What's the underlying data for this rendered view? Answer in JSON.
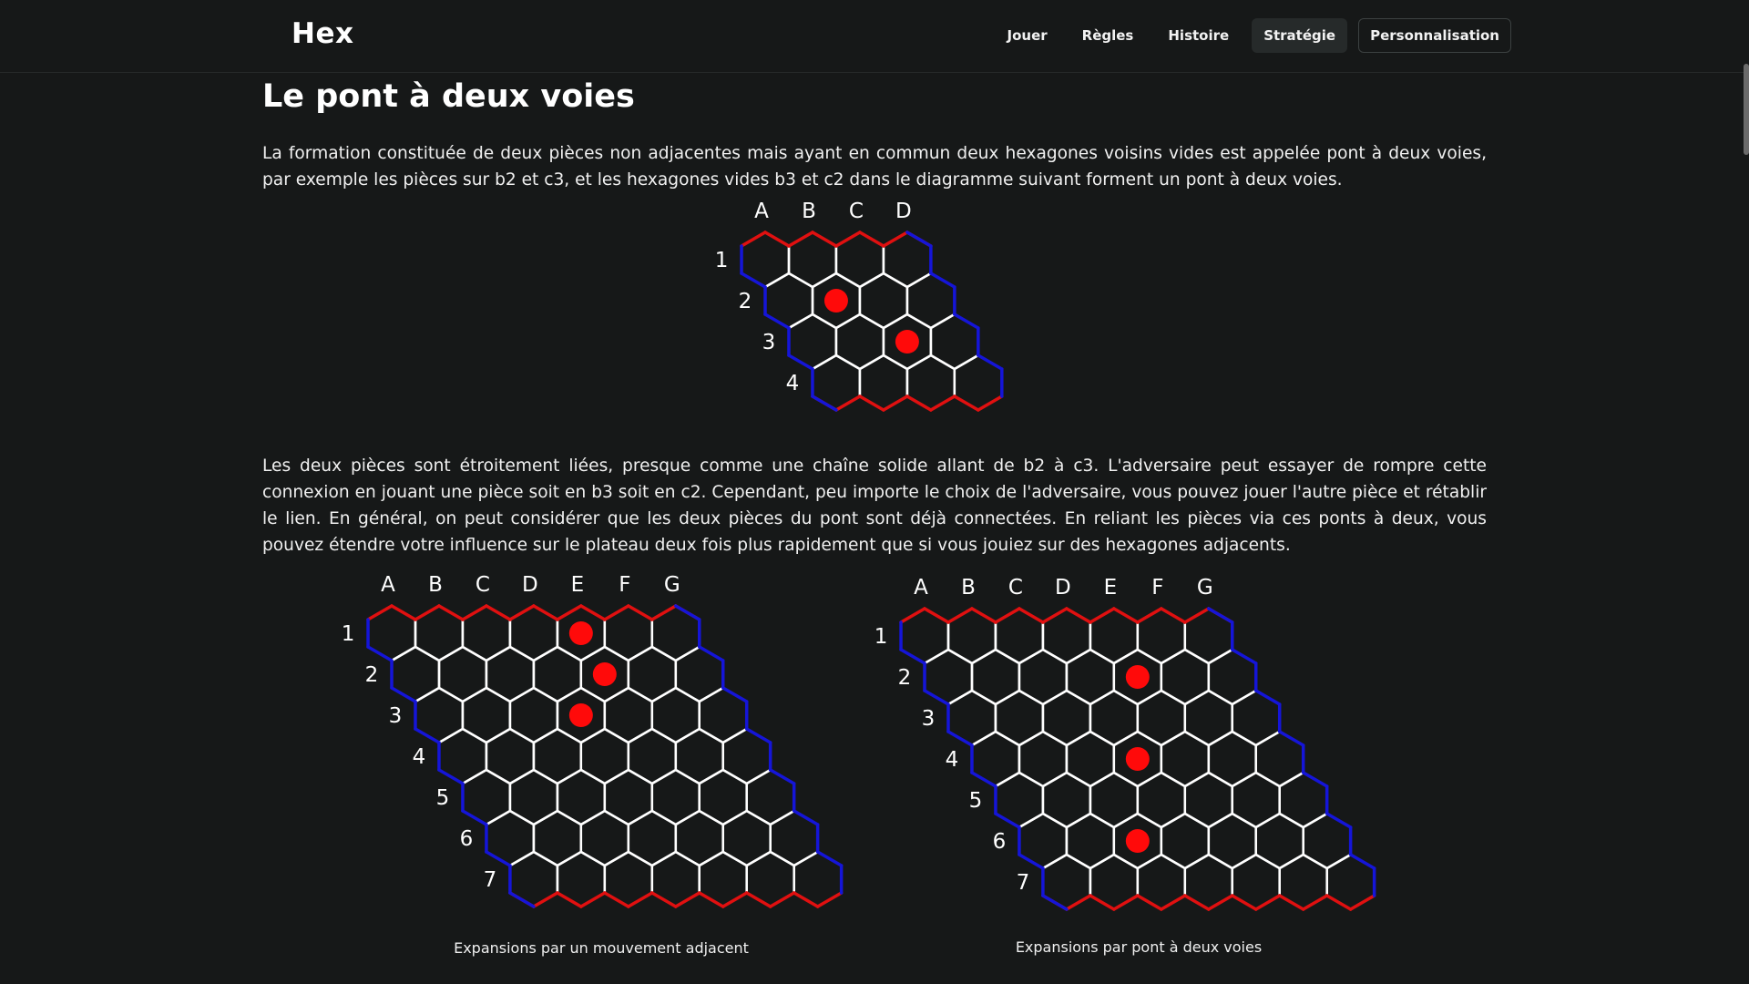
{
  "header": {
    "logo": "Hex",
    "nav": [
      {
        "label": "Jouer"
      },
      {
        "label": "Règles"
      },
      {
        "label": "Histoire"
      },
      {
        "label": "Stratégie",
        "active": true
      },
      {
        "label": "Personnalisation",
        "outlined": true
      }
    ]
  },
  "article": {
    "title": "Le pont à deux voies",
    "paragraph1": "La formation constituée de deux pièces non adjacentes mais ayant en commun deux hexagones voisins vides est appelée pont à deux voies, par exemple les pièces sur b2 et c3, et les hexagones vides b3 et c2 dans le diagramme suivant forment un pont à deux voies.",
    "paragraph2": "Les deux pièces sont étroitement liées, presque comme une chaîne solide allant de b2 à c3. L'adversaire peut essayer de rompre cette connexion en jouant une pièce soit en b3 soit en c2. Cependant, peu importe le choix de l'adversaire, vous pouvez jouer l'autre pièce et rétablir le lien. En général, on peut considérer que les deux pièces du pont sont déjà connectées. En reliant les pièces via ces ponts à deux, vous pouvez étendre votre influence sur le plateau deux fois plus rapidement que si vous jouiez sur des hexagones adjacents."
  },
  "colors": {
    "background": "#161818",
    "red_edge": "#e01010",
    "blue_edge": "#1515d8",
    "stone": "#ff0a0a",
    "grid": "#ffffff"
  },
  "boards": [
    {
      "id": "bridge-diagram",
      "size": 4,
      "columns": [
        "A",
        "B",
        "C",
        "D"
      ],
      "rows": [
        "1",
        "2",
        "3",
        "4"
      ],
      "stones": [
        "B2",
        "C3"
      ],
      "caption": ""
    },
    {
      "id": "adjacent-expansion",
      "size": 7,
      "columns": [
        "A",
        "B",
        "C",
        "D",
        "E",
        "F",
        "G"
      ],
      "rows": [
        "1",
        "2",
        "3",
        "4",
        "5",
        "6",
        "7"
      ],
      "stones": [
        "E1",
        "E2",
        "D3"
      ],
      "caption": "Expansions par un mouvement adjacent"
    },
    {
      "id": "bridge-expansion",
      "size": 7,
      "columns": [
        "A",
        "B",
        "C",
        "D",
        "E",
        "F",
        "G"
      ],
      "rows": [
        "1",
        "2",
        "3",
        "4",
        "5",
        "6",
        "7"
      ],
      "stones": [
        "E2",
        "D4",
        "C6"
      ],
      "caption": "Expansions par pont à deux voies"
    }
  ]
}
